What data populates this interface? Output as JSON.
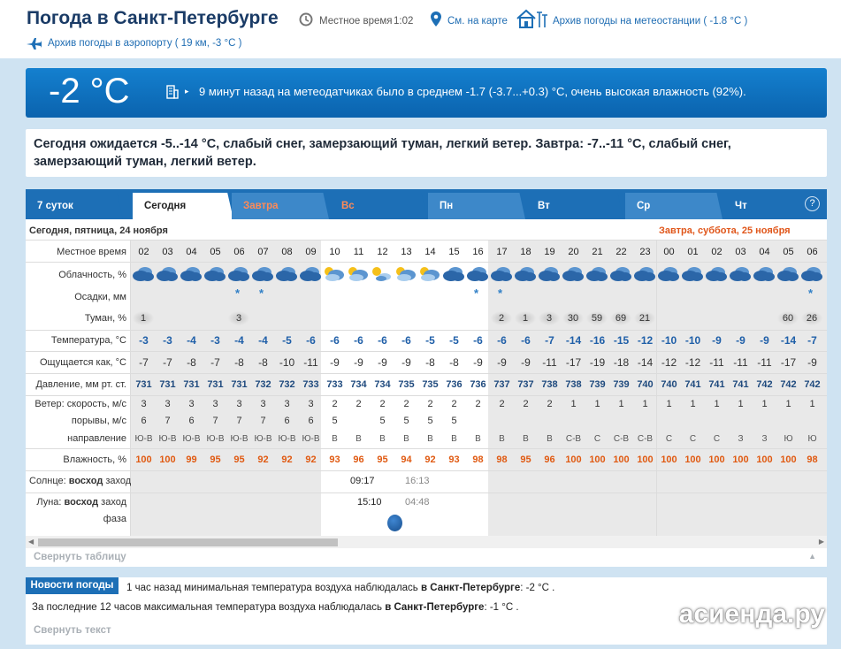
{
  "header": {
    "title": "Погода в Санкт-Петербурге",
    "local_time_label": "Местное время",
    "local_time": "1:02",
    "map_link": "См. на карте",
    "archive_station": "Архив погоды на метеостанции ( -1.8 °C )",
    "archive_airport": "Архив погоды в аэропорту ( 19 км, -3 °C )"
  },
  "current": {
    "temp": "-2 °C",
    "note": "9 минут назад на метеодатчиках было в среднем -1.7 (-3.7...+0.3) °C, очень высокая влажность (92%)."
  },
  "forecast_text": "Сегодня ожидается -5..-14 °C, слабый снег, замерзающий туман, легкий ветер. Завтра: -7..-11 °C, слабый снег, замерзающий туман, легкий ветер.",
  "tabs": [
    {
      "label": "7 суток"
    },
    {
      "label": "Сегодня"
    },
    {
      "label": "Завтра"
    },
    {
      "label": "Вс"
    },
    {
      "label": "Пн"
    },
    {
      "label": "Вт"
    },
    {
      "label": "Ср"
    },
    {
      "label": "Чт"
    }
  ],
  "help": "?",
  "dates": {
    "today": "Сегодня, пятница, 24 ноября",
    "tomorrow": "Завтра, суббота, 25 ноября"
  },
  "labels": {
    "time": "Местное время",
    "clouds": "Облачность, %",
    "precip": "Осадки, мм",
    "fog": "Туман, %",
    "temp": "Температура, °C",
    "feels": "Ощущается как, °C",
    "pressure": "Давление, мм рт. ст.",
    "wind": "Ветер: скорость, м/с",
    "gust": "порывы, м/с",
    "dir": "направление",
    "humidity": "Влажность, %",
    "sun": "Солнце:",
    "sun_rise": "восход",
    "sun_set": "заход",
    "moon": "Луна:",
    "moon_rise": "восход",
    "moon_set": "заход",
    "moon_phase": "фаза"
  },
  "hours": [
    "02",
    "03",
    "04",
    "05",
    "06",
    "07",
    "08",
    "09",
    "10",
    "11",
    "12",
    "13",
    "14",
    "15",
    "16",
    "17",
    "18",
    "19",
    "20",
    "21",
    "22",
    "23",
    "00",
    "01",
    "02",
    "03",
    "04",
    "05",
    "06"
  ],
  "cloud_type": [
    "o",
    "o",
    "o",
    "o",
    "o",
    "o",
    "o",
    "o",
    "p",
    "p",
    "s",
    "p",
    "p",
    "o",
    "o",
    "o",
    "o",
    "o",
    "o",
    "o",
    "o",
    "o",
    "o",
    "o",
    "o",
    "o",
    "o",
    "o",
    "o"
  ],
  "snow": [
    "",
    "",
    "",
    "",
    "*",
    "*",
    "",
    "",
    "",
    "",
    "",
    "",
    "",
    "",
    "*",
    "*",
    "",
    "",
    "",
    "",
    "",
    "",
    "",
    "",
    "",
    "",
    "",
    "",
    "*",
    "*"
  ],
  "fog": [
    "1",
    "",
    "",
    "",
    "3",
    "",
    "",
    "",
    "",
    "",
    "",
    "",
    "",
    "",
    "",
    "2",
    "1",
    "3",
    "30",
    "59",
    "69",
    "21",
    "",
    "",
    "",
    "",
    "",
    "60",
    "26"
  ],
  "temp": [
    "-3",
    "-3",
    "-4",
    "-3",
    "-4",
    "-4",
    "-5",
    "-6",
    "-6",
    "-6",
    "-6",
    "-6",
    "-5",
    "-5",
    "-6",
    "-6",
    "-6",
    "-7",
    "-14",
    "-16",
    "-15",
    "-12",
    "-10",
    "-10",
    "-9",
    "-9",
    "-9",
    "-14",
    "-7"
  ],
  "feels": [
    "-7",
    "-7",
    "-8",
    "-7",
    "-8",
    "-8",
    "-10",
    "-11",
    "-9",
    "-9",
    "-9",
    "-9",
    "-8",
    "-8",
    "-9",
    "-9",
    "-9",
    "-11",
    "-17",
    "-19",
    "-18",
    "-14",
    "-12",
    "-12",
    "-11",
    "-11",
    "-11",
    "-17",
    "-9"
  ],
  "pressure": [
    "731",
    "731",
    "731",
    "731",
    "731",
    "732",
    "732",
    "733",
    "733",
    "734",
    "734",
    "735",
    "735",
    "736",
    "736",
    "737",
    "737",
    "738",
    "738",
    "739",
    "739",
    "740",
    "740",
    "741",
    "741",
    "741",
    "742",
    "742",
    "742"
  ],
  "wind": [
    "3",
    "3",
    "3",
    "3",
    "3",
    "3",
    "3",
    "3",
    "2",
    "2",
    "2",
    "2",
    "2",
    "2",
    "2",
    "2",
    "2",
    "2",
    "1",
    "1",
    "1",
    "1",
    "1",
    "1",
    "1",
    "1",
    "1",
    "1",
    "1"
  ],
  "gust": [
    "6",
    "7",
    "6",
    "7",
    "7",
    "7",
    "6",
    "6",
    "5",
    "",
    "5",
    "5",
    "5",
    "5",
    "",
    "",
    "",
    "",
    "",
    "",
    "",
    "",
    "",
    "",
    "",
    "",
    "",
    "",
    ""
  ],
  "dir": [
    "Ю-В",
    "Ю-В",
    "Ю-В",
    "Ю-В",
    "Ю-В",
    "Ю-В",
    "Ю-В",
    "Ю-В",
    "В",
    "В",
    "В",
    "В",
    "В",
    "В",
    "В",
    "В",
    "В",
    "В",
    "С-В",
    "С",
    "С-В",
    "С-В",
    "С",
    "С",
    "С",
    "З",
    "З",
    "Ю",
    "Ю"
  ],
  "humidity": [
    "100",
    "100",
    "99",
    "95",
    "95",
    "92",
    "92",
    "92",
    "93",
    "96",
    "95",
    "94",
    "92",
    "93",
    "98",
    "98",
    "95",
    "96",
    "100",
    "100",
    "100",
    "100",
    "100",
    "100",
    "100",
    "100",
    "100",
    "100",
    "98"
  ],
  "sun": {
    "rise": "09:17",
    "set": "16:13"
  },
  "moon": {
    "rise": "15:10",
    "set": "04:48"
  },
  "collapse_table": "Свернуть таблицу",
  "news": {
    "tab": "Новости погоды",
    "line1_a": "1 час назад минимальная температура воздуха наблюдалась ",
    "line1_b": "в Санкт-Петербурге",
    "line1_c": ": -2 °C .",
    "line2_a": "За последние 12 часов максимальная температура воздуха наблюдалась ",
    "line2_b": "в Санкт-Петербурге",
    "line2_c": ": -1 °C .",
    "collapse": "Свернуть текст"
  },
  "watermark": "асиенда.ру"
}
